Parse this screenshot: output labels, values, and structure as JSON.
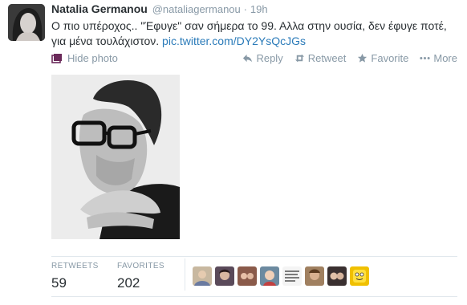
{
  "tweet": {
    "fullname": "Natalia Germanou",
    "username": "@nataliagermanou",
    "separator": "·",
    "time": "19h",
    "text": "Ο πιο υπέροχος.. \"Έφυγε\" σαν σήμερα το 99. Αλλα στην ουσία, δεν έφυγε ποτέ, για μένα τουλάχιστον. ",
    "pic_link": "pic.twitter.com/DY2YsQcJGs"
  },
  "hide_photo": {
    "label": "Hide photo",
    "icon": "photo-icon"
  },
  "actions": [
    {
      "id": "reply",
      "label": "Reply",
      "icon": "reply-icon"
    },
    {
      "id": "retweet",
      "label": "Retweet",
      "icon": "retweet-icon"
    },
    {
      "id": "favorite",
      "label": "Favorite",
      "icon": "star-icon"
    },
    {
      "id": "more",
      "label": "More",
      "icon": "more-dots-icon"
    }
  ],
  "stats": {
    "retweets": {
      "label": "RETWEETS",
      "value": "59"
    },
    "favorites": {
      "label": "FAVORITES",
      "value": "202"
    }
  },
  "colors": {
    "link": "#2b7bb9",
    "muted": "#8899a6",
    "text": "#292f33",
    "divider": "#e1e8ed"
  },
  "favoriters_count": 8
}
